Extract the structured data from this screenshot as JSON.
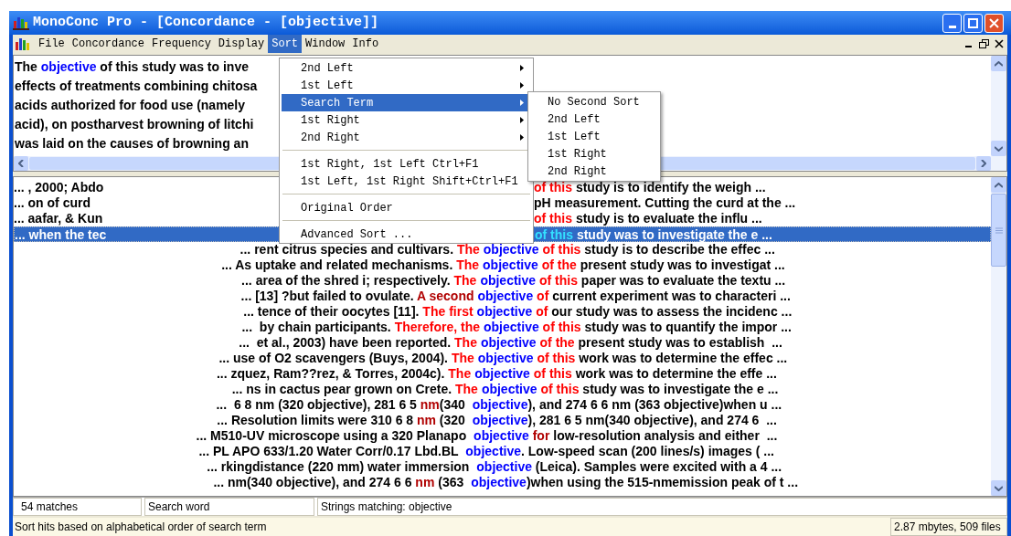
{
  "window": {
    "title": "MonoConc Pro - [Concordance - [objective]]"
  },
  "menu_bar": [
    {
      "label": "File",
      "selected": false
    },
    {
      "label": "Concordance",
      "selected": false
    },
    {
      "label": "Frequency",
      "selected": false
    },
    {
      "label": "Display",
      "selected": false
    },
    {
      "label": "Sort",
      "selected": true
    },
    {
      "label": "Window",
      "selected": false
    },
    {
      "label": "Info",
      "selected": false
    }
  ],
  "sort_menu": {
    "items": [
      {
        "kind": "item",
        "label": "2nd Left",
        "has_submenu": true,
        "selected": false
      },
      {
        "kind": "item",
        "label": "1st Left",
        "has_submenu": true,
        "selected": false
      },
      {
        "kind": "item",
        "label": "Search Term",
        "has_submenu": true,
        "selected": true
      },
      {
        "kind": "item",
        "label": "1st Right",
        "has_submenu": true,
        "selected": false
      },
      {
        "kind": "item",
        "label": "2nd Right",
        "has_submenu": true,
        "selected": false
      },
      {
        "kind": "separator"
      },
      {
        "kind": "item",
        "label": "1st Right, 1st Left",
        "shortcut": "Ctrl+F1",
        "has_submenu": false,
        "selected": false
      },
      {
        "kind": "item",
        "label": "1st Left, 1st Right",
        "shortcut": "Shift+Ctrl+F1",
        "has_submenu": false,
        "selected": false
      },
      {
        "kind": "separator"
      },
      {
        "kind": "item",
        "label": "Original Order",
        "has_submenu": false,
        "selected": false
      },
      {
        "kind": "separator"
      },
      {
        "kind": "item",
        "label": "Advanced Sort ...",
        "has_submenu": false,
        "selected": false
      }
    ]
  },
  "submenu": {
    "items": [
      {
        "label": "No Second Sort",
        "selected": false
      },
      {
        "label": "2nd Left",
        "selected": false
      },
      {
        "label": "1st Left",
        "selected": false
      },
      {
        "label": "1st Right",
        "selected": false
      },
      {
        "label": "2nd Right",
        "selected": false
      }
    ]
  },
  "text_pane": {
    "lines": [
      [
        {
          "text": "The ",
          "kind": "plain"
        },
        {
          "text": "objective",
          "kind": "keyword"
        },
        {
          "text": " of this study was to inve",
          "kind": "plain"
        }
      ],
      [
        {
          "text": "effects of treatments combining chitosa",
          "kind": "plain"
        }
      ],
      [
        {
          "text": "acids authorized for food use (namely",
          "kind": "plain"
        }
      ],
      [
        {
          "text": "acid), on postharvest browning of litchi",
          "kind": "plain"
        }
      ],
      [
        {
          "text": "was laid on the causes of browning an",
          "kind": "plain"
        }
      ]
    ]
  },
  "concordance": {
    "rows": [
      {
        "selected": false,
        "under_menu": true,
        "left": [
          {
            "text": "... , 2000; Abdo",
            "kind": "plain"
          }
        ],
        "right": [
          {
            "text": "of this",
            "kind": "collocate"
          },
          {
            "text": " study is to identify the weigh ...",
            "kind": "plain"
          }
        ]
      },
      {
        "selected": false,
        "under_menu": true,
        "left": [
          {
            "text": "... on of curd",
            "kind": "plain"
          }
        ],
        "right": [
          {
            "text": "pH measurement. Cutting the curd at the ...",
            "kind": "plain"
          }
        ]
      },
      {
        "selected": false,
        "under_menu": true,
        "left": [
          {
            "text": "... aafar, & Kun",
            "kind": "plain"
          }
        ],
        "right": [
          {
            "text": "of this",
            "kind": "collocate"
          },
          {
            "text": " study is to evaluate the influ ...",
            "kind": "plain"
          }
        ]
      },
      {
        "selected": true,
        "under_menu": true,
        "left": [
          {
            "text": "... when the tec",
            "kind": "plain"
          }
        ],
        "right": [
          {
            "text": "of this",
            "kind": "collocate"
          },
          {
            "text": " study was to investigate the e ...",
            "kind": "plain"
          }
        ]
      },
      {
        "selected": false,
        "under_menu": false,
        "left": [
          {
            "text": "... rent citrus species and cultivars. ",
            "kind": "plain"
          },
          {
            "text": "The",
            "kind": "collocate"
          }
        ],
        "right": [
          {
            "text": "objective",
            "kind": "keyword"
          },
          {
            "text": " of this",
            "kind": "collocate"
          },
          {
            "text": " study is to describe the effec ...",
            "kind": "plain"
          }
        ]
      },
      {
        "selected": false,
        "under_menu": false,
        "left": [
          {
            "text": "... As uptake and related mechanisms. ",
            "kind": "plain"
          },
          {
            "text": "The",
            "kind": "collocate"
          }
        ],
        "right": [
          {
            "text": "objective",
            "kind": "keyword"
          },
          {
            "text": " of the",
            "kind": "collocate"
          },
          {
            "text": " present study was to investigat ...",
            "kind": "plain"
          }
        ]
      },
      {
        "selected": false,
        "under_menu": false,
        "left": [
          {
            "text": "... area of the shred i; respectively. ",
            "kind": "plain"
          },
          {
            "text": "The",
            "kind": "collocate"
          }
        ],
        "right": [
          {
            "text": "objective",
            "kind": "keyword"
          },
          {
            "text": " of this",
            "kind": "collocate"
          },
          {
            "text": " paper was to evaluate the textu ...",
            "kind": "plain"
          }
        ]
      },
      {
        "selected": false,
        "under_menu": false,
        "left": [
          {
            "text": "... [13] ?but failed to ovulate. ",
            "kind": "plain"
          },
          {
            "text": "A second",
            "kind": "dark"
          }
        ],
        "right": [
          {
            "text": "objective",
            "kind": "keyword"
          },
          {
            "text": " of",
            "kind": "collocate"
          },
          {
            "text": " current experiment was to characteri ...",
            "kind": "plain"
          }
        ]
      },
      {
        "selected": false,
        "under_menu": false,
        "left": [
          {
            "text": "... tence of their oocytes [11]. ",
            "kind": "plain"
          },
          {
            "text": "The first",
            "kind": "collocate"
          }
        ],
        "right": [
          {
            "text": "objective",
            "kind": "keyword"
          },
          {
            "text": " of",
            "kind": "collocate"
          },
          {
            "text": " our study was to assess the incidenc ...",
            "kind": "plain"
          }
        ]
      },
      {
        "selected": false,
        "under_menu": false,
        "left": [
          {
            "text": "...  by chain participants. ",
            "kind": "plain"
          },
          {
            "text": "Therefore, the",
            "kind": "collocate"
          }
        ],
        "right": [
          {
            "text": "objective",
            "kind": "keyword"
          },
          {
            "text": " of this",
            "kind": "collocate"
          },
          {
            "text": " study was to quantify the impor ...",
            "kind": "plain"
          }
        ]
      },
      {
        "selected": false,
        "under_menu": false,
        "left": [
          {
            "text": "...  et al., 2003) have been reported. ",
            "kind": "plain"
          },
          {
            "text": "The",
            "kind": "collocate"
          }
        ],
        "right": [
          {
            "text": "objective",
            "kind": "keyword"
          },
          {
            "text": " of the",
            "kind": "collocate"
          },
          {
            "text": " present study was to establish  ...",
            "kind": "plain"
          }
        ]
      },
      {
        "selected": false,
        "under_menu": false,
        "left": [
          {
            "text": "... use of O2 scavengers (Buys, 2004). ",
            "kind": "plain"
          },
          {
            "text": "The",
            "kind": "collocate"
          }
        ],
        "right": [
          {
            "text": "objective",
            "kind": "keyword"
          },
          {
            "text": " of this",
            "kind": "collocate"
          },
          {
            "text": " work was to determine the effec ...",
            "kind": "plain"
          }
        ]
      },
      {
        "selected": false,
        "under_menu": false,
        "left": [
          {
            "text": "... zquez, Ram??rez, & Torres, 2004c). ",
            "kind": "plain"
          },
          {
            "text": "The",
            "kind": "collocate"
          }
        ],
        "right": [
          {
            "text": "objective",
            "kind": "keyword"
          },
          {
            "text": " of this",
            "kind": "collocate"
          },
          {
            "text": " work was to determine the effe ...",
            "kind": "plain"
          }
        ]
      },
      {
        "selected": false,
        "under_menu": false,
        "left": [
          {
            "text": "... ns in cactus pear grown on Crete. ",
            "kind": "plain"
          },
          {
            "text": "The",
            "kind": "collocate"
          }
        ],
        "right": [
          {
            "text": "objective",
            "kind": "keyword"
          },
          {
            "text": " of this",
            "kind": "collocate"
          },
          {
            "text": " study was to investigate the e ...",
            "kind": "plain"
          }
        ]
      },
      {
        "selected": false,
        "under_menu": false,
        "left": [
          {
            "text": "...  6 8 nm (320 objective), 281 6 5 ",
            "kind": "plain"
          },
          {
            "text": "nm",
            "kind": "dark"
          },
          {
            "text": "(340 ",
            "kind": "plain"
          }
        ],
        "right": [
          {
            "text": "objective",
            "kind": "keyword"
          },
          {
            "text": "), and 274 6 6 nm (363 objective)when u ...",
            "kind": "plain"
          }
        ]
      },
      {
        "selected": false,
        "under_menu": false,
        "left": [
          {
            "text": "... Resolution limits were 310 6 8 ",
            "kind": "plain"
          },
          {
            "text": "nm",
            "kind": "dark"
          },
          {
            "text": " (320 ",
            "kind": "plain"
          }
        ],
        "right": [
          {
            "text": "objective",
            "kind": "keyword"
          },
          {
            "text": "), 281 6 5 nm(340 objective), and 274 6  ...",
            "kind": "plain"
          }
        ]
      },
      {
        "selected": false,
        "under_menu": false,
        "left": [
          {
            "text": "... M510-UV microscope using a 320 Planapo ",
            "kind": "plain"
          }
        ],
        "right": [
          {
            "text": "objective",
            "kind": "keyword"
          },
          {
            "text": " for",
            "kind": "dark"
          },
          {
            "text": " low-resolution analysis and either  ...",
            "kind": "plain"
          }
        ]
      },
      {
        "selected": false,
        "under_menu": false,
        "left": [
          {
            "text": "... PL APO 633/1.20 Water Corr/0.17 Lbd.BL ",
            "kind": "plain"
          }
        ],
        "right": [
          {
            "text": "objective",
            "kind": "keyword"
          },
          {
            "text": ". Low-speed scan (200 lines/s) images ( ...",
            "kind": "plain"
          }
        ]
      },
      {
        "selected": false,
        "under_menu": false,
        "left": [
          {
            "text": "... rkingdistance (220 mm) water immersion ",
            "kind": "plain"
          }
        ],
        "right": [
          {
            "text": "objective",
            "kind": "keyword"
          },
          {
            "text": " (Leica). Samples were excited with a 4 ...",
            "kind": "plain"
          }
        ]
      },
      {
        "selected": false,
        "under_menu": false,
        "left": [
          {
            "text": "... nm(340 objective), and 274 6 6 ",
            "kind": "plain"
          },
          {
            "text": "nm",
            "kind": "dark"
          },
          {
            "text": " (363 ",
            "kind": "plain"
          }
        ],
        "right": [
          {
            "text": "objective",
            "kind": "keyword"
          },
          {
            "text": ")when using the 515-nmemission peak of t ...",
            "kind": "plain"
          }
        ]
      }
    ]
  },
  "status_bar": {
    "matches": "54 matches",
    "search_mode": "Search word",
    "strings": "Strings matching: objective"
  },
  "hint_bar": {
    "message": "Sort hits based on alphabetical order of search term",
    "info": "2.87 mbytes, 509 files"
  }
}
